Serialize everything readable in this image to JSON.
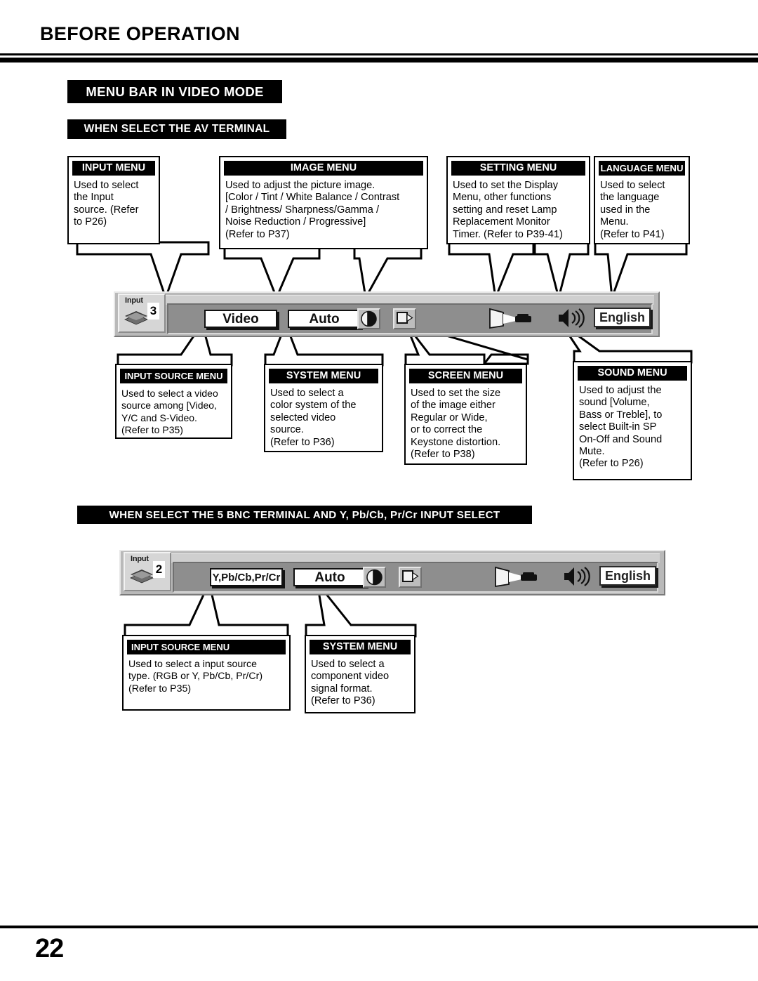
{
  "page": {
    "chapter_title": "BEFORE OPERATION",
    "page_number": "22"
  },
  "banners": {
    "menu_bar_in_video_mode": "MENU BAR IN VIDEO MODE",
    "when_select_av_terminal": "WHEN SELECT THE AV TERMINAL",
    "when_select_bnc_terminal": "WHEN SELECT THE 5 BNC TERMINAL AND Y, Pb/Cb, Pr/Cr INPUT SELECT"
  },
  "section_av": {
    "callouts_top": [
      {
        "title": "INPUT MENU",
        "body": "Used to select\nthe Input\nsource. (Refer\nto P26)"
      },
      {
        "title": "IMAGE MENU",
        "body": "Used to adjust the picture image.\n[Color / Tint / White Balance / Contrast\n/ Brightness/ Sharpness/Gamma /\nNoise  Reduction / Progressive]\n(Refer to P37)"
      },
      {
        "title": "SETTING MENU",
        "body": "Used to set the Display\nMenu, other functions\nsetting and reset Lamp\nReplacement Monitor\nTimer. (Refer to P39-41)"
      },
      {
        "title": "LANGUAGE MENU",
        "body": "Used to select\nthe language\nused in the\nMenu.\n(Refer to P41)"
      }
    ],
    "callouts_bottom": [
      {
        "title": "INPUT SOURCE MENU",
        "body": "Used to select a video\nsource among [Video,\nY/C and S-Video.\n(Refer to P35)"
      },
      {
        "title": "SYSTEM MENU",
        "body": "Used to select a\ncolor system of the\nselected video\nsource.\n(Refer to P36)"
      },
      {
        "title": "SCREEN MENU",
        "body": "Used to set the size\nof the image either\nRegular or  Wide,\nor to correct the\nKeystone distortion.\n(Refer to P38)"
      },
      {
        "title": "SOUND MENU",
        "body": "Used to adjust the\nsound [Volume,\nBass or Treble], to\nselect Built-in SP\nOn-Off and Sound\nMute.\n(Refer to P26)"
      }
    ],
    "menubar": {
      "input_tab_label": "Input",
      "input_index": "3",
      "source_value": "Video",
      "system_value": "Auto",
      "language_value": "English",
      "icons": [
        "layers-icon",
        "contrast-icon",
        "screen-size-icon",
        "projection-screen-icon",
        "speaker-icon"
      ]
    }
  },
  "section_bnc": {
    "callouts": [
      {
        "title": "INPUT SOURCE MENU",
        "body": "Used to select a input source\ntype. (RGB or Y, Pb/Cb, Pr/Cr)\n(Refer to P35)"
      },
      {
        "title": "SYSTEM MENU",
        "body": "Used to select a\ncomponent video\nsignal format.\n(Refer to P36)"
      }
    ],
    "menubar": {
      "input_tab_label": "Input",
      "input_index": "2",
      "source_value": "Y,Pb/Cb,Pr/Cr",
      "system_value": "Auto",
      "language_value": "English",
      "icons": [
        "layers-icon",
        "contrast-icon",
        "screen-size-icon",
        "projection-screen-icon",
        "speaker-icon"
      ]
    }
  },
  "colors": {
    "ink": "#000000",
    "paper": "#ffffff",
    "menubar_face": "#b9b9b9",
    "menubar_inner": "#8e8e8e"
  }
}
